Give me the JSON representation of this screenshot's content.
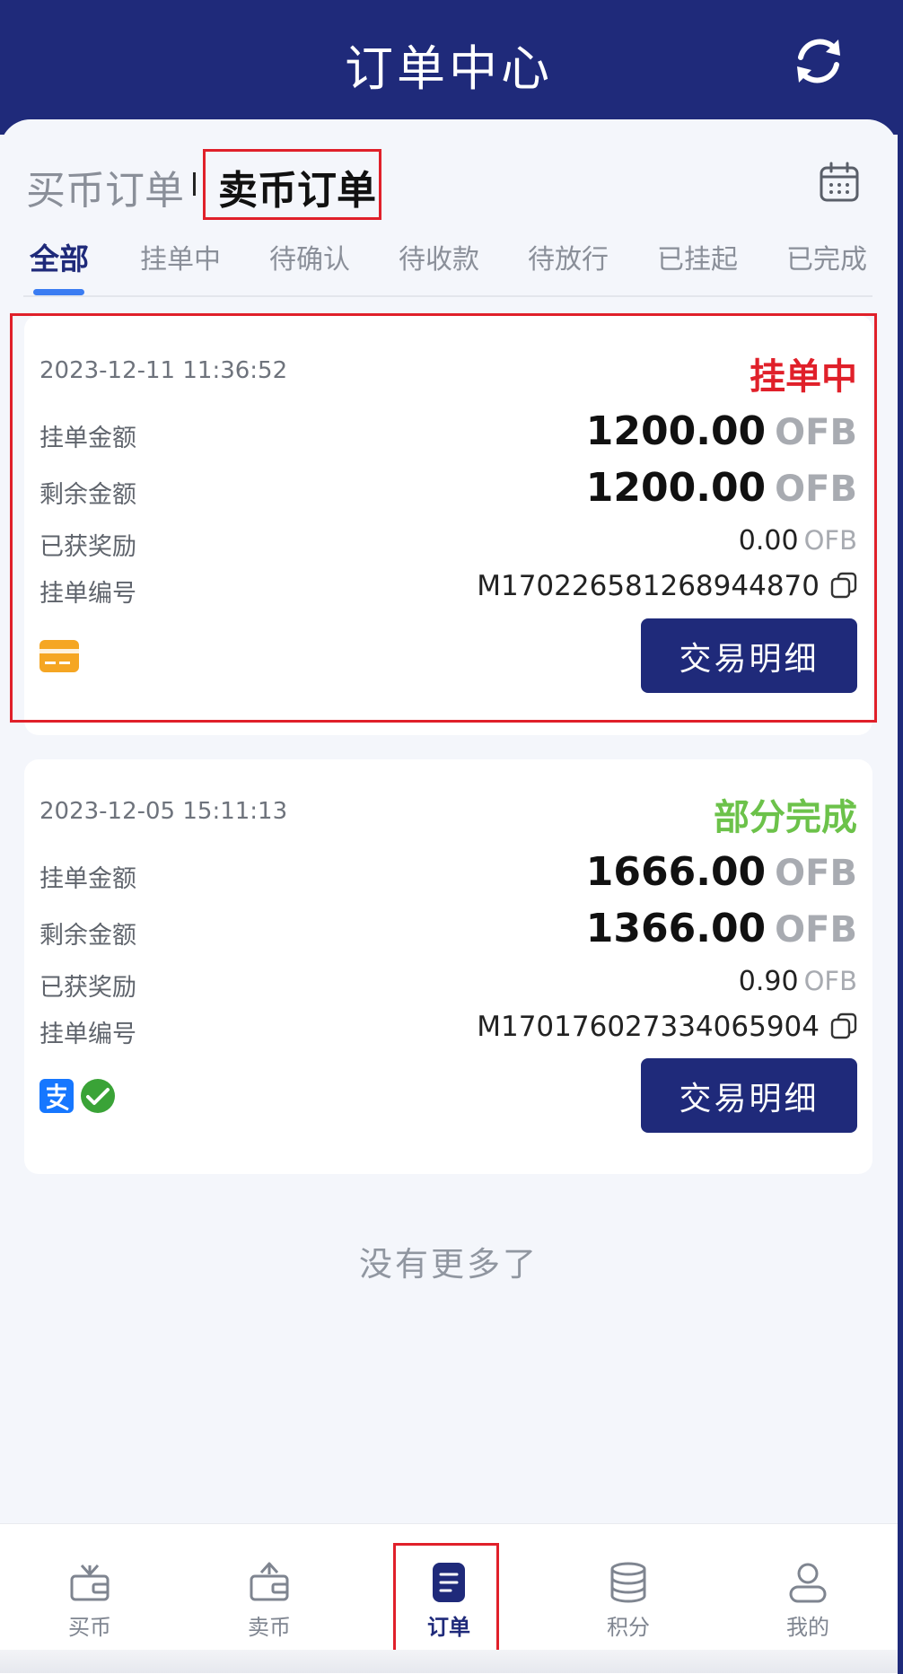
{
  "header": {
    "title": "订单中心",
    "refresh_icon": "refresh-icon"
  },
  "order_types": {
    "buy": "买币订单",
    "sell": "卖币订单",
    "selected": "sell"
  },
  "calendar_icon": "calendar-icon",
  "tabs": [
    {
      "label": "全部",
      "active": true
    },
    {
      "label": "挂单中",
      "active": false
    },
    {
      "label": "待确认",
      "active": false
    },
    {
      "label": "待收款",
      "active": false
    },
    {
      "label": "待放行",
      "active": false
    },
    {
      "label": "已挂起",
      "active": false
    },
    {
      "label": "已完成",
      "active": false
    }
  ],
  "orders": [
    {
      "datetime": "2023-12-11 11:36:52",
      "status": "挂单中",
      "status_color": "#e0202a",
      "listing_amount_label": "挂单金额",
      "listing_amount": "1200.00",
      "remaining_amount_label": "剩余金额",
      "remaining_amount": "1200.00",
      "reward_label": "已获奖励",
      "reward": "0.00",
      "order_no_label": "挂单编号",
      "order_no": "M170226581268944870",
      "unit": "OFB",
      "payment_methods": [
        "bank-card-icon"
      ],
      "detail_button": "交易明细"
    },
    {
      "datetime": "2023-12-05 15:11:13",
      "status": "部分完成",
      "status_color": "#6cc24a",
      "listing_amount_label": "挂单金额",
      "listing_amount": "1666.00",
      "remaining_amount_label": "剩余金额",
      "remaining_amount": "1366.00",
      "reward_label": "已获奖励",
      "reward": "0.90",
      "order_no_label": "挂单编号",
      "order_no": "M170176027334065904",
      "unit": "OFB",
      "payment_methods": [
        "alipay-icon",
        "wechat-pay-icon"
      ],
      "detail_button": "交易明细"
    }
  ],
  "footer_text": "没有更多了",
  "bottom_nav": [
    {
      "label": "买币",
      "icon": "buy-coin-icon",
      "active": false
    },
    {
      "label": "卖币",
      "icon": "sell-coin-icon",
      "active": false
    },
    {
      "label": "订单",
      "icon": "order-icon",
      "active": true
    },
    {
      "label": "积分",
      "icon": "points-icon",
      "active": false
    },
    {
      "label": "我的",
      "icon": "profile-icon",
      "active": false
    }
  ],
  "colors": {
    "primary": "#1f2a7a",
    "accent_blue": "#3a7cf2",
    "highlight_red": "#e0202a",
    "pending_red": "#e0202a",
    "partial_green": "#6cc24a"
  }
}
